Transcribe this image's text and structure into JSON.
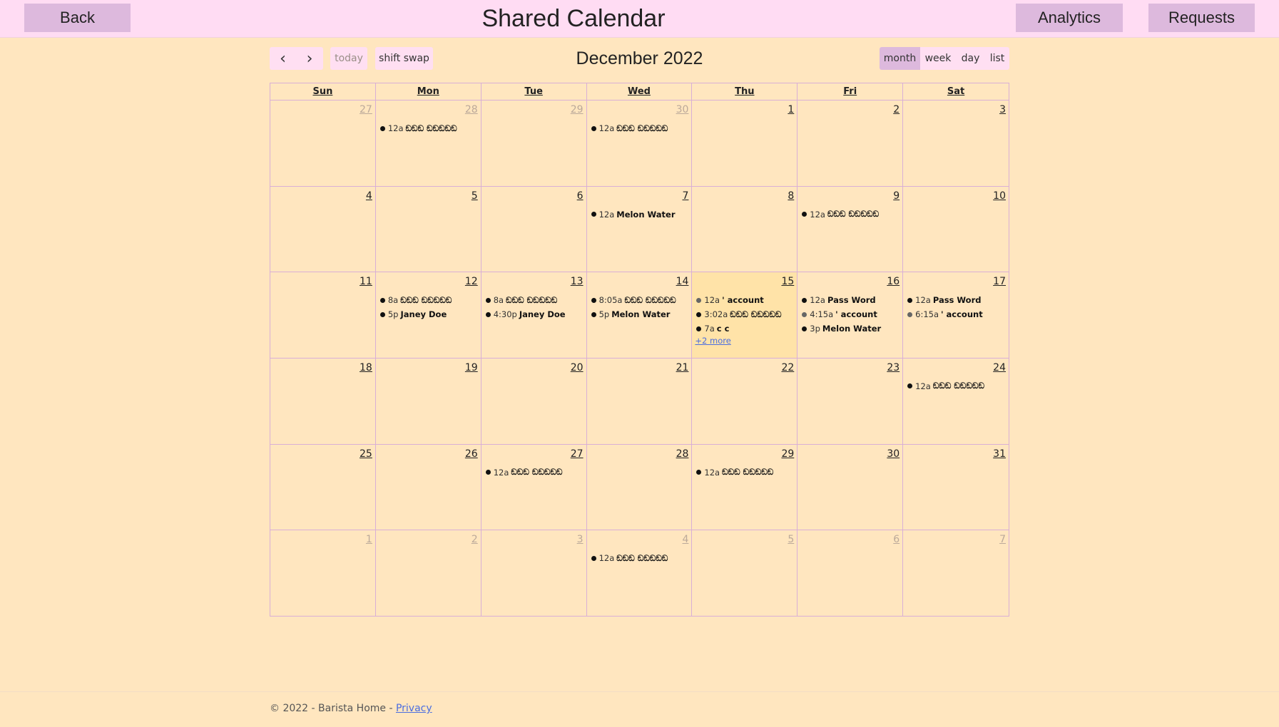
{
  "header": {
    "back_label": "Back",
    "title": "Shared Calendar",
    "analytics_label": "Analytics",
    "requests_label": "Requests"
  },
  "toolbar": {
    "prev_icon": "‹",
    "next_icon": "›",
    "today_label": "today",
    "shift_swap_label": "shift swap",
    "title": "December 2022",
    "views": [
      "month",
      "week",
      "day",
      "list"
    ],
    "active_view": "month"
  },
  "calendar": {
    "weekdays": [
      "Sun",
      "Mon",
      "Tue",
      "Wed",
      "Thu",
      "Fri",
      "Sat"
    ],
    "today": "15",
    "weeks": [
      [
        {
          "num": "27",
          "other": true,
          "events": []
        },
        {
          "num": "28",
          "other": true,
          "events": [
            {
              "time": "12a",
              "title": "ඞඞඞ ඞඞඞඞඞ"
            }
          ]
        },
        {
          "num": "29",
          "other": true,
          "events": []
        },
        {
          "num": "30",
          "other": true,
          "events": [
            {
              "time": "12a",
              "title": "ඞඞඞ ඞඞඞඞඞ"
            }
          ]
        },
        {
          "num": "1",
          "events": []
        },
        {
          "num": "2",
          "events": []
        },
        {
          "num": "3",
          "events": []
        }
      ],
      [
        {
          "num": "4",
          "events": []
        },
        {
          "num": "5",
          "events": []
        },
        {
          "num": "6",
          "events": []
        },
        {
          "num": "7",
          "events": [
            {
              "time": "12a",
              "title": "Melon Water"
            }
          ]
        },
        {
          "num": "8",
          "events": []
        },
        {
          "num": "9",
          "events": [
            {
              "time": "12a",
              "title": "ඞඞඞ ඞඞඞඞඞ"
            }
          ]
        },
        {
          "num": "10",
          "events": []
        }
      ],
      [
        {
          "num": "11",
          "events": []
        },
        {
          "num": "12",
          "events": [
            {
              "time": "8a",
              "title": "ඞඞඞ ඞඞඞඞඞ"
            },
            {
              "time": "5p",
              "title": "Janey Doe"
            }
          ]
        },
        {
          "num": "13",
          "events": [
            {
              "time": "8a",
              "title": "ඞඞඞ ඞඞඞඞඞ"
            },
            {
              "time": "4:30p",
              "title": "Janey Doe"
            }
          ]
        },
        {
          "num": "14",
          "events": [
            {
              "time": "8:05a",
              "title": "ඞඞඞ ඞඞඞඞඞ"
            },
            {
              "time": "5p",
              "title": "Melon Water"
            }
          ]
        },
        {
          "num": "15",
          "events": [
            {
              "time": "12a",
              "title": "' account",
              "grey": true
            },
            {
              "time": "3:02a",
              "title": "ඞඞඞ ඞඞඞඞඞ"
            },
            {
              "time": "7a",
              "title": "c c"
            }
          ],
          "more": "+2 more"
        },
        {
          "num": "16",
          "events": [
            {
              "time": "12a",
              "title": "Pass Word"
            },
            {
              "time": "4:15a",
              "title": "' account",
              "grey": true
            },
            {
              "time": "3p",
              "title": "Melon Water"
            }
          ]
        },
        {
          "num": "17",
          "events": [
            {
              "time": "12a",
              "title": "Pass Word"
            },
            {
              "time": "6:15a",
              "title": "' account",
              "grey": true
            }
          ]
        }
      ],
      [
        {
          "num": "18",
          "events": []
        },
        {
          "num": "19",
          "events": []
        },
        {
          "num": "20",
          "events": []
        },
        {
          "num": "21",
          "events": []
        },
        {
          "num": "22",
          "events": []
        },
        {
          "num": "23",
          "events": []
        },
        {
          "num": "24",
          "events": [
            {
              "time": "12a",
              "title": "ඞඞඞ ඞඞඞඞඞ"
            }
          ]
        }
      ],
      [
        {
          "num": "25",
          "events": []
        },
        {
          "num": "26",
          "events": []
        },
        {
          "num": "27",
          "events": [
            {
              "time": "12a",
              "title": "ඞඞඞ ඞඞඞඞඞ"
            }
          ]
        },
        {
          "num": "28",
          "events": []
        },
        {
          "num": "29",
          "events": [
            {
              "time": "12a",
              "title": "ඞඞඞ ඞඞඞඞඞ"
            }
          ]
        },
        {
          "num": "30",
          "events": []
        },
        {
          "num": "31",
          "events": []
        }
      ],
      [
        {
          "num": "1",
          "other": true,
          "events": []
        },
        {
          "num": "2",
          "other": true,
          "events": []
        },
        {
          "num": "3",
          "other": true,
          "events": []
        },
        {
          "num": "4",
          "other": true,
          "events": [
            {
              "time": "12a",
              "title": "ඞඞඞ ඞඞඞඞඞ"
            }
          ]
        },
        {
          "num": "5",
          "other": true,
          "events": []
        },
        {
          "num": "6",
          "other": true,
          "events": []
        },
        {
          "num": "7",
          "other": true,
          "events": []
        }
      ]
    ]
  },
  "footer": {
    "text": "© 2022 - Barista Home - ",
    "privacy_label": "Privacy"
  },
  "colors": {
    "page_background": "#ffe6bf",
    "header_background": "#ffdcf3",
    "button_background": "#ddb9dd",
    "today_background": "#ffe3a8",
    "grid_border": "#d9afd6",
    "link": "#4a6de0"
  }
}
